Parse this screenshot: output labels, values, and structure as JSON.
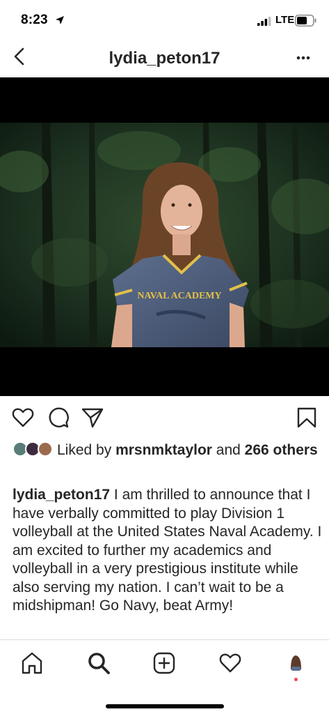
{
  "status_bar": {
    "time": "8:23",
    "network": "LTE"
  },
  "header": {
    "username": "lydia_peton17"
  },
  "post": {
    "image_alt": "Photo of a girl in a Naval Academy Annapolis shirt standing in front of trees",
    "shirt_text": "NAVAL ACADEMY"
  },
  "likes": {
    "prefix": "Liked by ",
    "liked_by_user": "mrsnmktaylor",
    "middle": " and ",
    "others_count": "266",
    "suffix": " others"
  },
  "caption": {
    "username": "lydia_peton17",
    "text": " I am thrilled to announce that I have verbally committed to play Division 1 volleyball at the United States Naval Academy. I am excited to further my academics and volleyball in a very prestigious institute while also serving my nation. I can’t wait to be a midshipman!  Go Navy, beat Army!"
  },
  "icons": {
    "back": "chevron-left-icon",
    "more": "more-horizontal-icon",
    "like": "heart-icon",
    "comment": "comment-bubble-icon",
    "share": "paper-plane-icon",
    "save": "bookmark-icon",
    "home": "home-icon",
    "search": "search-icon",
    "new_post": "plus-square-icon",
    "activity": "heart-icon",
    "profile": "profile-avatar"
  },
  "colors": {
    "text": "#262626",
    "divider": "#dbdbdb",
    "notification": "#ed4956"
  }
}
